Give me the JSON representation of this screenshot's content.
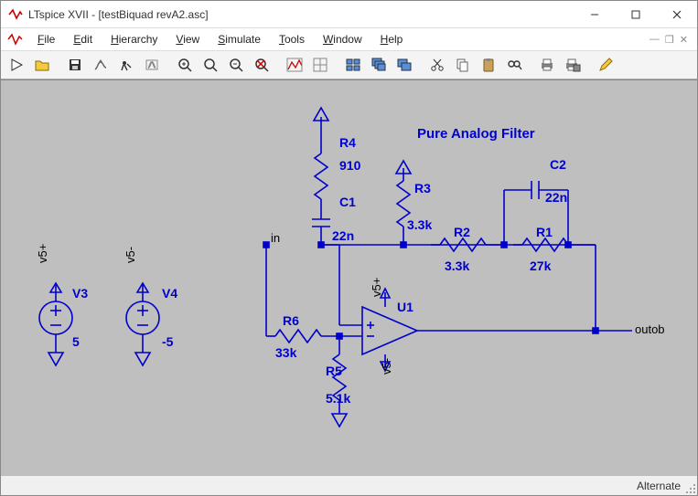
{
  "window": {
    "title": "LTspice XVII - [testBiquad revA2.asc]"
  },
  "menus": {
    "file": "File",
    "edit": "Edit",
    "hierarchy": "Hierarchy",
    "view": "View",
    "simulate": "Simulate",
    "tools": "Tools",
    "window": "Window",
    "help": "Help"
  },
  "status": {
    "mode": "Alternate"
  },
  "schematic": {
    "title": "Pure Analog Filter",
    "nets": {
      "in": "in",
      "out": "outob",
      "v5p": "v5+",
      "v5n": "v5-",
      "v5p2": "v5+",
      "v5n2": "v5-"
    },
    "comp": {
      "R1": {
        "ref": "R1",
        "val": "27k"
      },
      "R2": {
        "ref": "R2",
        "val": "3.3k"
      },
      "R3": {
        "ref": "R3",
        "val": "3.3k"
      },
      "R4": {
        "ref": "R4",
        "val": "910"
      },
      "R5": {
        "ref": "R5",
        "val": "5.1k"
      },
      "R6": {
        "ref": "R6",
        "val": "33k"
      },
      "C1": {
        "ref": "C1",
        "val": "22n"
      },
      "C2": {
        "ref": "C2",
        "val": "22n"
      },
      "U1": {
        "ref": "U1"
      },
      "V3": {
        "ref": "V3",
        "val": "5"
      },
      "V4": {
        "ref": "V4",
        "val": "-5"
      }
    }
  }
}
